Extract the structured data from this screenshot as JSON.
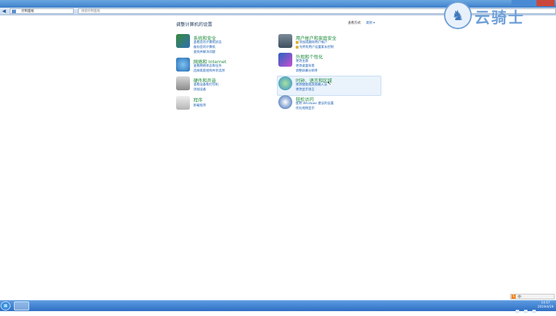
{
  "window": {},
  "address": {
    "path": "控制面板",
    "search_placeholder": "搜索控制面板"
  },
  "header": {
    "title": "调整计算机的设置",
    "view_label": "查看方式:",
    "view_value": "类别 ▾"
  },
  "categories": [
    {
      "title": "系统和安全",
      "links": [
        "查看您的计算机状态",
        "备份您的计算机",
        "查找并解决问题"
      ]
    },
    {
      "title": "网络和 Internet",
      "links": [
        "查看网络状态和任务",
        "选择家庭组和共享选项"
      ]
    },
    {
      "title": "硬件和声音",
      "links": [
        "查看设备和打印机",
        "添加设备"
      ]
    },
    {
      "title": "程序",
      "links": [
        "卸载程序"
      ]
    },
    {
      "title": "用户帐户和家庭安全",
      "links": [
        "添加或删除用户帐户",
        "为所有用户设置家长控制"
      ]
    },
    {
      "title": "外观和个性化",
      "links": [
        "更改主题",
        "更改桌面背景",
        "调整屏幕分辨率"
      ]
    },
    {
      "title": "时钟、语言和区域",
      "links": [
        "更改键盘或其他输入法",
        "更改显示语言"
      ]
    },
    {
      "title": "轻松访问",
      "links": [
        "使用 Windows 建议的设置",
        "优化视频显示"
      ]
    }
  ],
  "logo": {
    "text": "云骑士"
  },
  "taskbar": {
    "time": "14:57",
    "date": "2019/4/29"
  },
  "ime": {
    "mode": "中"
  },
  "colors": {
    "title_green": "#1d8a3d",
    "link_blue": "#1a5fb4",
    "taskbar": "#2f6fc4"
  }
}
